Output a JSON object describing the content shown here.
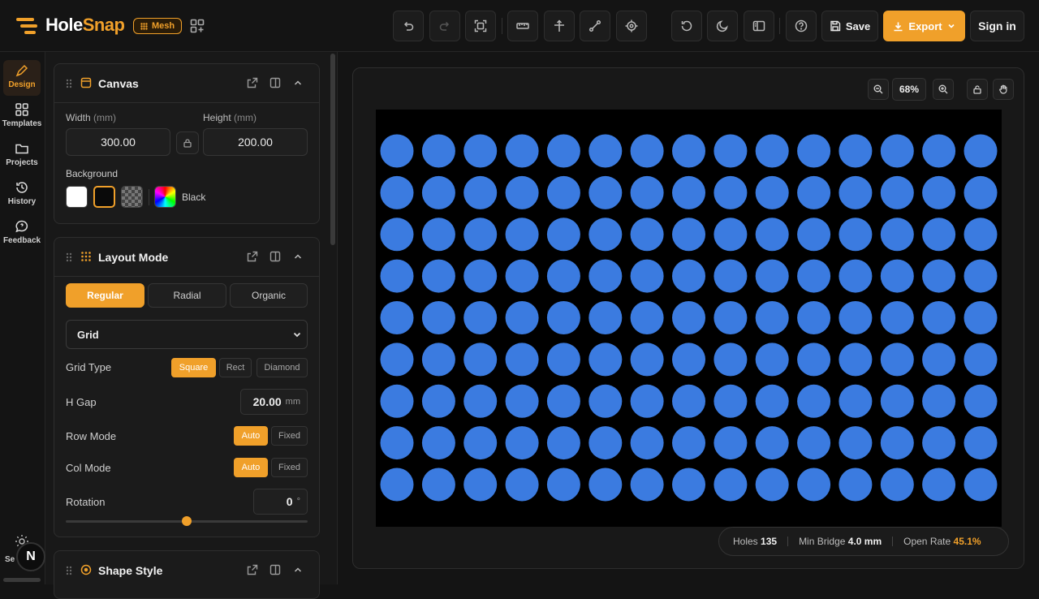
{
  "app": {
    "name_part1": "Hole",
    "name_part2": "Snap",
    "badge": "Mesh"
  },
  "toolbar": {
    "buttons": [
      "undo-icon",
      "redo-icon",
      "fit-view-icon",
      "ruler-icon",
      "move-icon",
      "path-icon",
      "target-icon",
      "reset-icon",
      "moon-icon",
      "panel-icon",
      "help-icon"
    ],
    "save_label": "Save",
    "export_label": "Export",
    "signin_label": "Sign in"
  },
  "rail": {
    "items": [
      {
        "label": "Design",
        "icon": "pen-icon",
        "active": true
      },
      {
        "label": "Templates",
        "icon": "grid-icon",
        "active": false
      },
      {
        "label": "Projects",
        "icon": "folder-icon",
        "active": false
      },
      {
        "label": "History",
        "icon": "history-icon",
        "active": false
      },
      {
        "label": "Feedback",
        "icon": "chat-icon",
        "active": false
      }
    ],
    "bottom_label": "Se",
    "avatar_letter": "N"
  },
  "canvas_card": {
    "title": "Canvas",
    "width_label": "Width",
    "height_label": "Height",
    "unit_label": "(mm)",
    "width_value": "300.00",
    "height_value": "200.00",
    "background_label": "Background",
    "background_name": "Black"
  },
  "layout_card": {
    "title": "Layout Mode",
    "modes": [
      "Regular",
      "Radial",
      "Organic"
    ],
    "active_mode": "Regular",
    "pattern": "Grid",
    "grid_type_label": "Grid Type",
    "grid_types": [
      "Square",
      "Rect",
      "Diamond"
    ],
    "h_gap_label": "H Gap",
    "h_gap_value": "20.00",
    "h_gap_unit": "mm",
    "row_mode_label": "Row Mode",
    "col_mode_label": "Col Mode",
    "mode_options": [
      "Auto",
      "Fixed"
    ],
    "rotation_label": "Rotation",
    "rotation_value": "0",
    "rotation_unit": "°",
    "rotation_fraction": 0.5
  },
  "shape_card": {
    "title": "Shape Style"
  },
  "stage": {
    "zoom": "68%",
    "hole_color": "#3b7be0",
    "background_color": "#000000",
    "rows": 9,
    "cols": 15
  },
  "stats": {
    "holes_label": "Holes",
    "holes_value": "135",
    "bridge_label": "Min Bridge",
    "bridge_value": "4.0 mm",
    "open_label": "Open Rate",
    "open_value": "45.1%"
  }
}
